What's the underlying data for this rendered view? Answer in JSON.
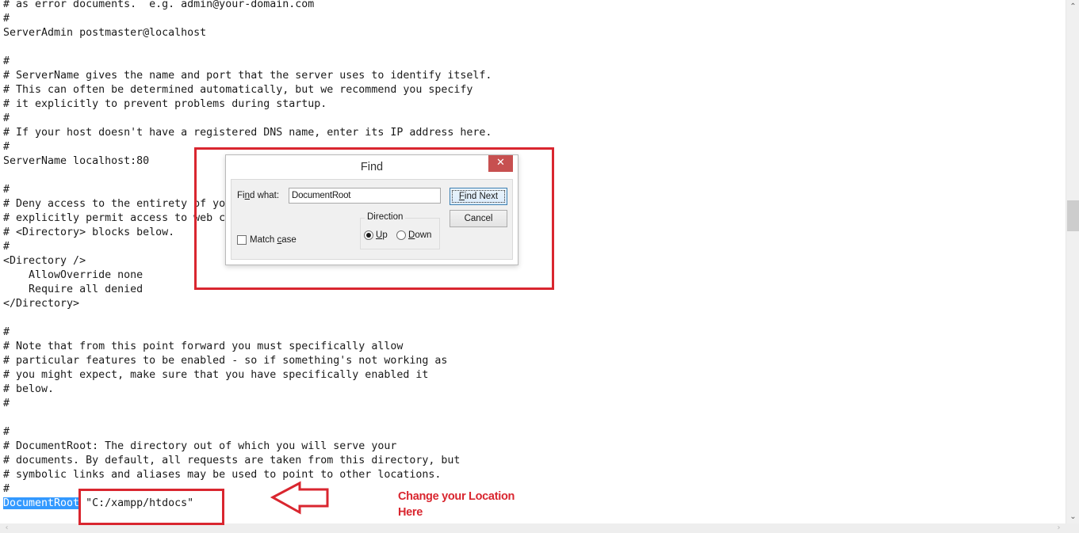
{
  "editor": {
    "lines": [
      "# as error documents.  e.g. admin@your-domain.com",
      "#",
      "ServerAdmin postmaster@localhost",
      "",
      "#",
      "# ServerName gives the name and port that the server uses to identify itself.",
      "# This can often be determined automatically, but we recommend you specify",
      "# it explicitly to prevent problems during startup.",
      "#",
      "# If your host doesn't have a registered DNS name, enter its IP address here.",
      "#",
      "ServerName localhost:80",
      "",
      "#",
      "# Deny access to the entirety of your server's filesystem. You must",
      "# explicitly permit access to web content directories in other",
      "# <Directory> blocks below.",
      "#",
      "<Directory />",
      "    AllowOverride none",
      "    Require all denied",
      "</Directory>",
      "",
      "#",
      "# Note that from this point forward you must specifically allow",
      "# particular features to be enabled - so if something's not working as",
      "# you might expect, make sure that you have specifically enabled it",
      "# below.",
      "#",
      "",
      "#",
      "# DocumentRoot: The directory out of which you will serve your",
      "# documents. By default, all requests are taken from this directory, but",
      "# symbolic links and aliases may be used to point to other locations.",
      "#"
    ],
    "last_line": {
      "selected_text": "DocumentRoot",
      "rest": " \"C:/xampp/htdocs\""
    }
  },
  "find_dialog": {
    "title": "Find",
    "close_glyph": "✕",
    "find_what_label_pre": "Fi",
    "find_what_label_mnemonic": "n",
    "find_what_label_post": "d what:",
    "find_what_value": "DocumentRoot",
    "find_next_mnemonic": "F",
    "find_next_rest": "ind Next",
    "cancel_label": "Cancel",
    "match_case_pre": "Match ",
    "match_case_mnemonic": "c",
    "match_case_post": "ase",
    "match_case_checked": false,
    "direction_label": "Direction",
    "direction_up_mnemonic": "U",
    "direction_up_rest": "p",
    "direction_down_mnemonic": "D",
    "direction_down_rest": "own",
    "direction_selected": "Up"
  },
  "annotation": {
    "line1": "Change your Location",
    "line2": "Here",
    "color": "#d9262f"
  },
  "scrollbars": {
    "up_glyph": "⌃",
    "down_glyph": "⌄",
    "left_glyph": "‹",
    "right_glyph": "›"
  }
}
